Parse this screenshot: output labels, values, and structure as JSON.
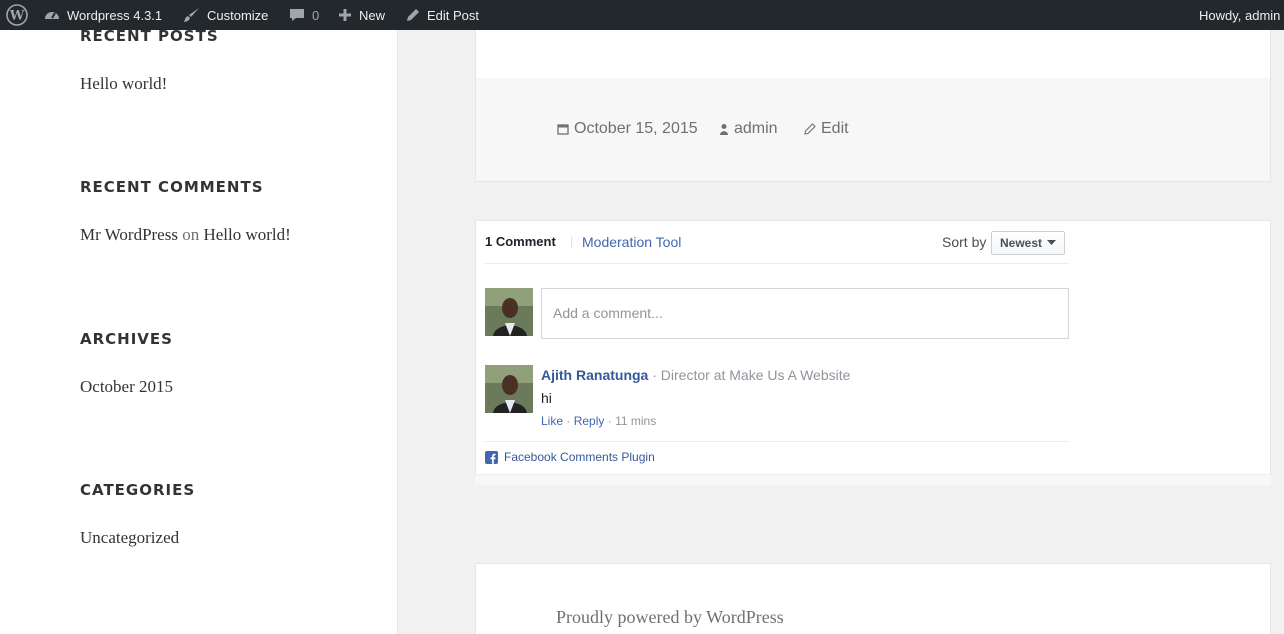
{
  "adminbar": {
    "site_name": "Wordpress 4.3.1",
    "customize": "Customize",
    "comments_count": "0",
    "new": "New",
    "edit_post": "Edit Post",
    "howdy": "Howdy, admin"
  },
  "sidebar": {
    "recent_posts": {
      "title": "RECENT POSTS",
      "items": [
        "Hello world!"
      ]
    },
    "recent_comments": {
      "title": "RECENT COMMENTS",
      "author": "Mr WordPress",
      "on": "on",
      "post": "Hello world!"
    },
    "archives": {
      "title": "ARCHIVES",
      "items": [
        "October 2015"
      ]
    },
    "categories": {
      "title": "CATEGORIES",
      "items": [
        "Uncategorized"
      ]
    }
  },
  "post_meta": {
    "date": "October 15, 2015",
    "author": "admin",
    "edit": "Edit"
  },
  "fb_comments": {
    "count_label": "1 Comment",
    "separator": "|",
    "moderation": "Moderation Tool",
    "sort_by": "Sort by",
    "sort_value": "Newest",
    "placeholder": "Add a comment...",
    "comments": [
      {
        "author": "Ajith Ranatunga",
        "dot": "·",
        "title": "Director at Make Us A Website",
        "text": "hi",
        "like": "Like",
        "reply": "Reply",
        "time": "11 mins"
      }
    ],
    "plugin_label": "Facebook Comments Plugin"
  },
  "footer": {
    "powered": "Proudly powered by WordPress"
  },
  "colors": {
    "adminbar": "#23282d",
    "fb_blue": "#365899",
    "fb_gray": "#90949c"
  }
}
